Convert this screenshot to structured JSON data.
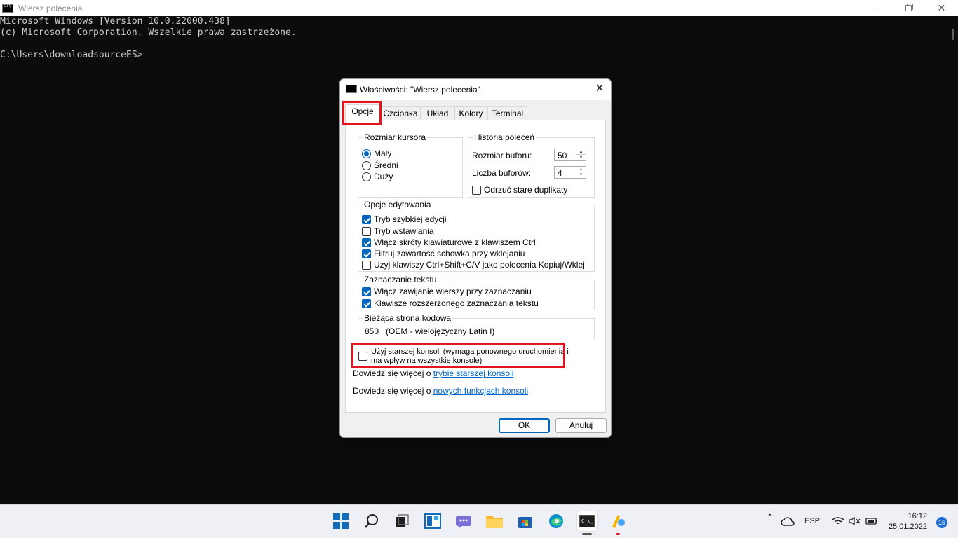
{
  "console": {
    "title": "Wiersz polecenia",
    "lines": [
      "Microsoft Windows [Version 10.0.22000.438]",
      "(c) Microsoft Corporation. Wszelkie prawa zastrzeżone.",
      "",
      "C:\\Users\\downloadsourceES>"
    ]
  },
  "dialog": {
    "title": "Właściwości: \"Wiersz polecenia\"",
    "close": "✕",
    "tabs": [
      "Opcje",
      "Czcionka",
      "Układ",
      "Kolory",
      "Terminal"
    ],
    "active_tab": "Opcje",
    "cursor_size": {
      "label": "Rozmiar kursora",
      "options": [
        "Mały",
        "Średni",
        "Duży"
      ],
      "selected": "Mały"
    },
    "history": {
      "label": "Historia poleceń",
      "buffer_size_label": "Rozmiar buforu:",
      "buffer_size_value": "50",
      "buffer_count_label": "Liczba buforów:",
      "buffer_count_value": "4",
      "discard_label": "Odrzuć stare duplikaty",
      "discard_checked": false
    },
    "edit_options": {
      "label": "Opcje edytowania",
      "items": [
        {
          "label": "Tryb szybkiej edycji",
          "checked": true
        },
        {
          "label": "Tryb wstawiania",
          "checked": false
        },
        {
          "label": "Włącz skróty klawiaturowe z klawiszem Ctrl",
          "checked": true
        },
        {
          "label": "Filtruj zawartość schowka przy wklejaniu",
          "checked": true
        },
        {
          "label": "Użyj klawiszy Ctrl+Shift+C/V jako polecenia Kopiuj/Wklej",
          "checked": false
        }
      ]
    },
    "text_selection": {
      "label": "Zaznaczanie tekstu",
      "items": [
        {
          "label": "Włącz zawijanie wierszy przy zaznaczaniu",
          "checked": true
        },
        {
          "label": "Klawisze rozszerzonego zaznaczania tekstu",
          "checked": true
        }
      ]
    },
    "codepage": {
      "label": "Bieżąca strona kodowa",
      "value": "850   (OEM - wielojęzyczny Latin I)"
    },
    "legacy": {
      "line1": "Użyj starszej konsoli (wymaga ponownego uruchomienia i",
      "line2": "ma wpływ na wszystkie konsole)",
      "checked": false
    },
    "learn1": {
      "prefix": "Dowiedz się więcej o ",
      "link": "trybie starszej konsoli"
    },
    "learn2": {
      "prefix": "Dowiedz się więcej o ",
      "link": "nowych funkcjach konsoli"
    },
    "ok": "OK",
    "cancel": "Anuluj"
  },
  "highlight_color": "#e4141e",
  "accent_color": "#0067c0",
  "taskbar": {
    "icons": [
      "windows-start-icon",
      "search-icon",
      "task-view-icon",
      "widgets-icon",
      "teams-chat-icon",
      "file-explorer-icon",
      "store-icon",
      "edge-icon",
      "terminal-icon",
      "paint-app-icon"
    ],
    "tray": {
      "chevron": "⌃",
      "language": "ESP",
      "time": "16:12",
      "date": "25.01.2022",
      "notifications": "15"
    }
  }
}
